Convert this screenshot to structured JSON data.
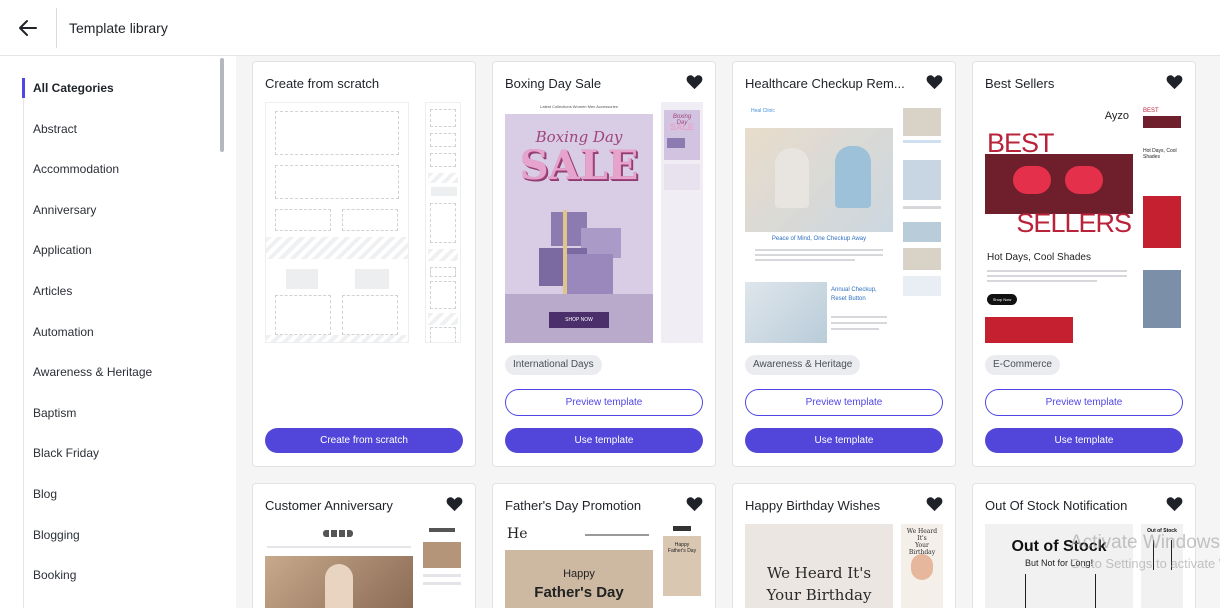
{
  "header": {
    "title": "Template library",
    "back_icon": "arrow-left-icon"
  },
  "sidebar": {
    "items": [
      {
        "label": "All Categories",
        "active": true
      },
      {
        "label": "Abstract"
      },
      {
        "label": "Accommodation"
      },
      {
        "label": "Anniversary"
      },
      {
        "label": "Application"
      },
      {
        "label": "Articles"
      },
      {
        "label": "Automation"
      },
      {
        "label": "Awareness & Heritage"
      },
      {
        "label": "Baptism"
      },
      {
        "label": "Black Friday"
      },
      {
        "label": "Blog"
      },
      {
        "label": "Blogging"
      },
      {
        "label": "Booking"
      }
    ]
  },
  "cards": [
    {
      "title": "Create from scratch",
      "primary_button": "Create from scratch"
    },
    {
      "title": "Boxing Day Sale",
      "tag": "International Days",
      "preview_button": "Preview template",
      "use_button": "Use template",
      "thumb_text": {
        "nav": "Latest Collections  Women  Men  Accessories",
        "headline_1": "Boxing Day",
        "headline_2": "SALE",
        "cta": "SHOP NOW"
      }
    },
    {
      "title": "Healthcare Checkup Rem...",
      "tag": "Awareness & Heritage",
      "preview_button": "Preview template",
      "use_button": "Use template",
      "thumb_text": {
        "brand": "Heal Clinic",
        "headline": "Peace of Mind, One Checkup Away",
        "section": "Annual Checkup, Reset Button"
      }
    },
    {
      "title": "Best Sellers",
      "tag": "E-Commerce",
      "preview_button": "Preview template",
      "use_button": "Use template",
      "thumb_text": {
        "brand": "Ayzo",
        "headline_1": "BEST",
        "headline_2": "SELLERS",
        "subhead": "Hot Days, Cool Shades",
        "cta": "Shop Now"
      }
    },
    {
      "title": "Customer Anniversary"
    },
    {
      "title": "Father's Day Promotion",
      "thumb_text": {
        "brand": "He",
        "headline_1": "Happy",
        "headline_2": "Father's Day"
      }
    },
    {
      "title": "Happy Birthday Wishes",
      "thumb_text": {
        "headline_1": "We Heard It's",
        "headline_2": "Your Birthday"
      }
    },
    {
      "title": "Out Of Stock Notification",
      "thumb_text": {
        "headline_1": "Out of Stock",
        "headline_2": "But Not for Long!"
      }
    }
  ],
  "os_watermark": {
    "line1": "Activate Windows",
    "line2": "Go to Settings to activate Windows."
  },
  "colors": {
    "accent": "#5146d9",
    "background": "#f5f5f6"
  }
}
